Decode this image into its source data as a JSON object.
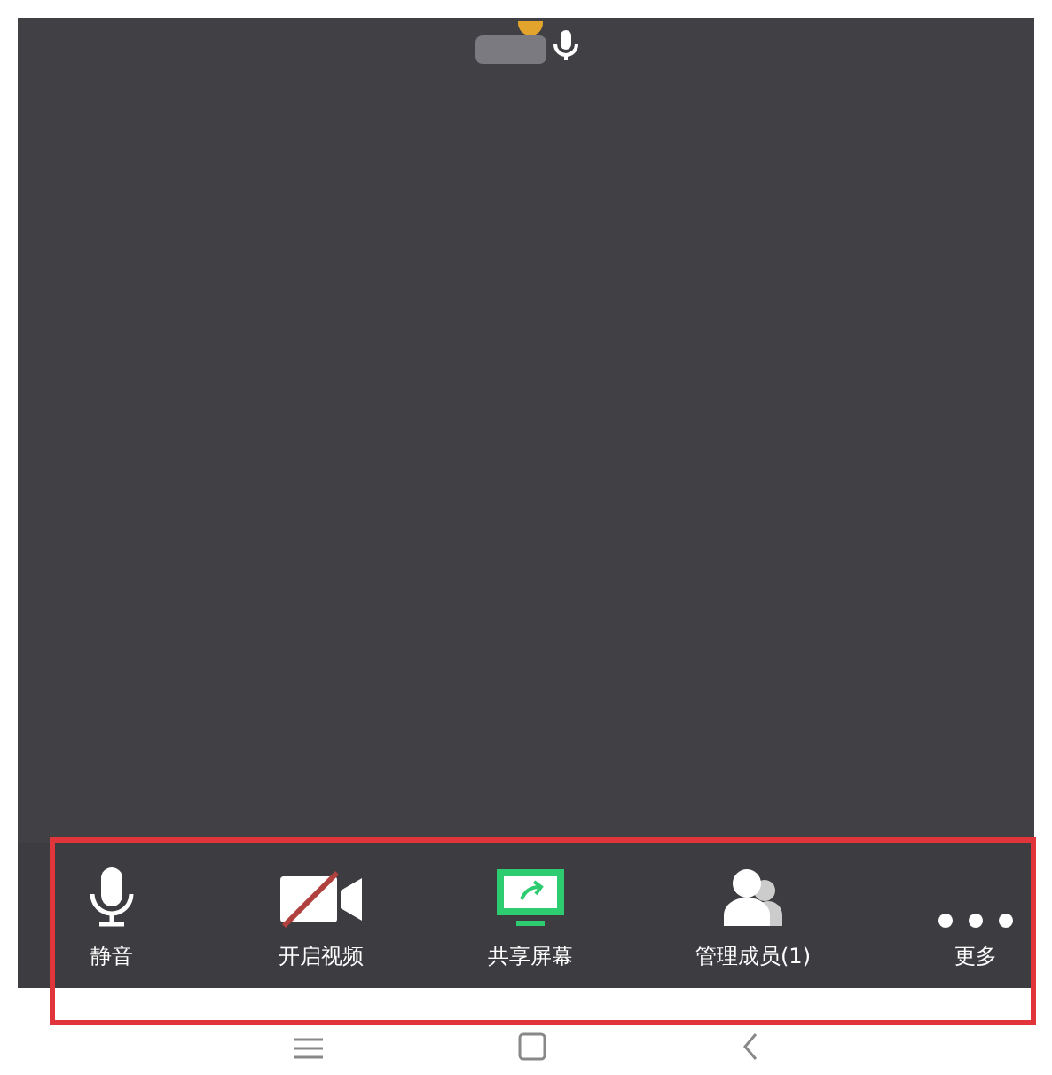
{
  "participant": {
    "mic_on": true
  },
  "toolbar": {
    "buttons": [
      {
        "kind": "mic",
        "label": "静音"
      },
      {
        "kind": "video-off",
        "label": "开启视频"
      },
      {
        "kind": "share",
        "label": "共享屏幕"
      },
      {
        "kind": "members",
        "label": "管理成员(1)"
      },
      {
        "kind": "more",
        "label": "更多"
      }
    ]
  }
}
